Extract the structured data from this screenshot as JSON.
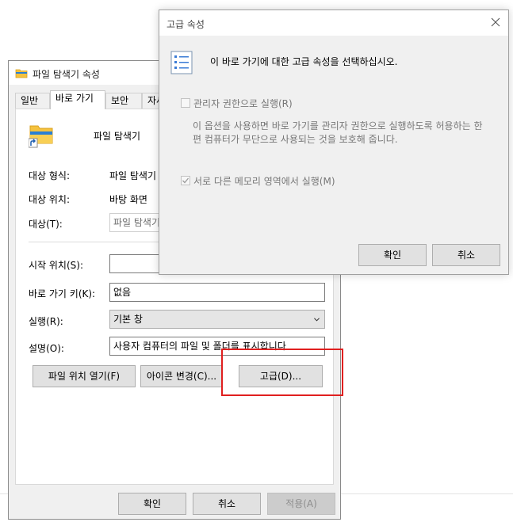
{
  "properties_dialog": {
    "title": "파일 탐색기 속성",
    "tabs": [
      "일반",
      "바로 가기",
      "보안",
      "자세"
    ],
    "app_name": "파일 탐색기",
    "fields": {
      "target_type_label": "대상 형식:",
      "target_type_value": "파일 탐색기",
      "target_location_label": "대상 위치:",
      "target_location_value": "바탕 화면",
      "target_label": "대상(T):",
      "target_value": "파일 탐색기",
      "start_in_label": "시작 위치(S):",
      "start_in_value": "",
      "shortcut_key_label": "바로 가기 키(K):",
      "shortcut_key_value": "없음",
      "run_label": "실행(R):",
      "run_value": "기본 창",
      "comment_label": "설명(O):",
      "comment_value": "사용자 컴퓨터의 파일 및 폴더를 표시합니다"
    },
    "buttons": {
      "open_location": "파일 위치 열기(F)",
      "change_icon": "아이콘 변경(C)...",
      "advanced": "고급(D)...",
      "ok": "확인",
      "cancel": "취소",
      "apply": "적용(A)"
    }
  },
  "advanced_dialog": {
    "title": "고급 속성",
    "heading": "이 바로 가기에 대한 고급 속성을 선택하십시오.",
    "run_as_admin": {
      "label": "관리자 권한으로 실행(R)",
      "checked": false,
      "description": "이 옵션을 사용하면 바로 가기를 관리자 권한으로 실행하도록 허용하는 한편 컴퓨터가 무단으로 사용되는 것을 보호해 줍니다."
    },
    "separate_memory": {
      "label": "서로 다른 메모리 영역에서 실행(M)",
      "checked": true
    },
    "buttons": {
      "ok": "확인",
      "cancel": "취소"
    }
  },
  "colors": {
    "highlight": "#e01f1f",
    "folder": "#f5c23e"
  }
}
